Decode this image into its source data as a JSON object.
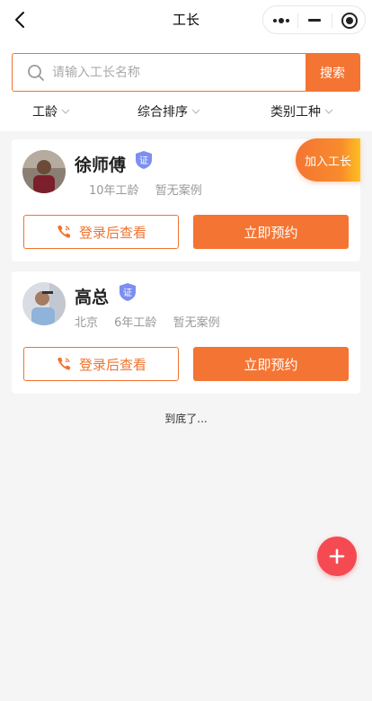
{
  "nav": {
    "title": "工长"
  },
  "search": {
    "placeholder": "请输入工长名称",
    "value": "",
    "button_label": "搜索"
  },
  "filters": [
    {
      "label": "工龄"
    },
    {
      "label": "综合排序"
    },
    {
      "label": "类别工种"
    }
  ],
  "join_button_label": "加入工长",
  "workers": [
    {
      "name": "徐师傅",
      "verified_label": "证",
      "location": "",
      "experience": "10年工龄",
      "cases": "暂无案例",
      "login_button_label": "登录后查看",
      "book_button_label": "立即预约"
    },
    {
      "name": "高总",
      "verified_label": "证",
      "location": "北京",
      "experience": "6年工龄",
      "cases": "暂无案例",
      "login_button_label": "登录后查看",
      "book_button_label": "立即预约"
    }
  ],
  "end_text": "到底了...",
  "colors": {
    "accent": "#f47533",
    "badge": "#7b8ff0",
    "fab": "#f54a52",
    "background": "#f5f5f5"
  },
  "icons": {
    "back": "chevron-left-icon",
    "more": "more-dots-icon",
    "minimize": "minus-icon",
    "close": "target-icon",
    "search": "search-icon",
    "filter": "chevron-down-icon",
    "phone": "phone-icon",
    "verified": "shield-badge-icon",
    "add": "plus-icon"
  }
}
